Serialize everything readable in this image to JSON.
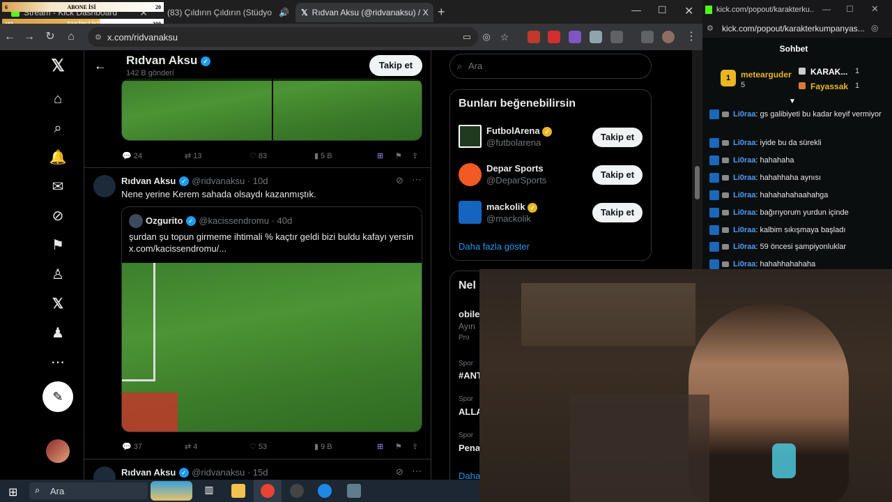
{
  "overlay": {
    "abone": {
      "label": "ABONE İSİ",
      "left": "6",
      "right": "20"
    },
    "takipci": {
      "label": "TAKİPÇİ İSİ",
      "left": "183",
      "right": "300"
    }
  },
  "browser": {
    "tabs": [
      {
        "title": "Stream - Kick Dashboard"
      },
      {
        "title": "(83) Çıldırın Çıldırın (Stüdyo"
      },
      {
        "title": "Rıdvan Aksu (@ridvanaksu) / X"
      }
    ],
    "url": "x.com/ridvanaksu"
  },
  "profile": {
    "name": "Rıdvan Aksu",
    "posts": "142 B gönderi",
    "follow": "Takip et"
  },
  "posts": [
    {
      "stats": {
        "replies": "24",
        "reposts": "13",
        "likes": "83",
        "views": "5 B"
      }
    },
    {
      "name": "Rıdvan Aksu",
      "handle": "@ridvanaksu · 10d",
      "text": "Nene yerine Kerem sahada olsaydı kazanmıştık.",
      "quote": {
        "name": "Ozgurito",
        "handle": "@kacissendromu · 40d",
        "text": "şurdan şu topun girmeme ihtimali % kaçtır geldi bizi buldu kafayı yersin",
        "link": "x.com/kacissendromu/..."
      },
      "stats": {
        "replies": "37",
        "reposts": "4",
        "likes": "53",
        "views": "9 B"
      }
    },
    {
      "name": "Rıdvan Aksu",
      "handle": "@ridvanaksu · 15d"
    }
  ],
  "right": {
    "search": "Ara",
    "suggest_title": "Bunları beğenebilirsin",
    "suggestions": [
      {
        "name": "FutbolArena",
        "handle": "@futbolarena",
        "button": "Takip et"
      },
      {
        "name": "Depar Sports",
        "handle": "@DeparSports",
        "button": "Takip et"
      },
      {
        "name": "mackolik",
        "handle": "@mackolik",
        "button": "Takip et"
      }
    ],
    "show_more": "Daha fazla göster",
    "trends_title": "Nel",
    "trends": [
      {
        "a": "obile",
        "b": "Ayın",
        "c": "Pro"
      },
      {
        "a": "Spor",
        "b": "#ANT"
      },
      {
        "a": "Spor",
        "b": "ALLA"
      },
      {
        "a": "Spor",
        "b": "Pena"
      }
    ],
    "trends_more": "Daha"
  },
  "kick": {
    "url_top": "kick.com/popout/karakterku...",
    "url": "kick.com/popout/karakterkumpanyas...",
    "chat_title": "Sohbet",
    "leaders": [
      {
        "name": "metearguder",
        "count": "5"
      },
      {
        "name": "KARAK...",
        "count": "1"
      },
      {
        "name": "Fayassak",
        "count": "1"
      }
    ],
    "messages": [
      {
        "user": "Li0raa",
        "text": ": gs galibiyeti bu kadar keyif vermiyor"
      },
      {
        "user": "Li0raa",
        "text": ": iyide bu da sürekli"
      },
      {
        "user": "Li0raa",
        "text": ": hahahaha"
      },
      {
        "user": "Li0raa",
        "text": ": hahahhaha aynısı"
      },
      {
        "user": "Li0raa",
        "text": ": hahahahahaahahga"
      },
      {
        "user": "Li0raa",
        "text": ": bağırıyorum yurdun içinde"
      },
      {
        "user": "Li0raa",
        "text": ": kalbim sıkışmaya başladı"
      },
      {
        "user": "Li0raa",
        "text": ": 59 öncesi şampiyonluklar"
      },
      {
        "user": "Li0raa",
        "text": ": hahahhahahaha"
      }
    ]
  },
  "taskbar": {
    "search": "Ara"
  }
}
